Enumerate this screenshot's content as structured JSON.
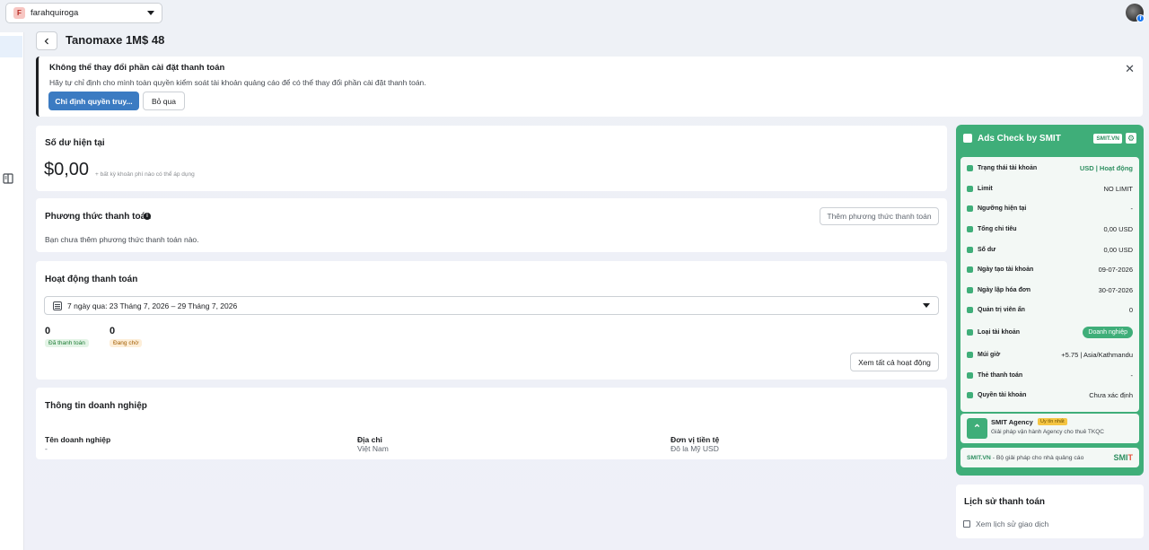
{
  "account": {
    "initial": "F",
    "name": "farahquiroga"
  },
  "header": {
    "title": "Tanomaxe 1M$ 48"
  },
  "banner": {
    "title": "Không thể thay đổi phần cài đặt thanh toán",
    "text": "Hãy tự chỉ định cho mình toàn quyền kiểm soát tài khoản quảng cáo để có thể thay đổi phần cài đặt thanh toán.",
    "primary_label": "Chỉ định quyền truy...",
    "secondary_label": "Bỏ qua"
  },
  "balance": {
    "title": "Số dư hiện tại",
    "amount": "$0,00",
    "note": "+ bất kỳ khoản phí nào có thể áp dụng"
  },
  "payment": {
    "title": "Phương thức thanh toán",
    "add_label": "Thêm phương thức thanh toán",
    "empty_text": "Bạn chưa thêm phương thức thanh toán nào."
  },
  "activity": {
    "title": "Hoạt động thanh toán",
    "date_range": "7 ngày qua: 23 Tháng 7, 2026 – 29 Tháng 7, 2026",
    "paid_count": "0",
    "paid_label": "Đã thanh toán",
    "pending_count": "0",
    "pending_label": "Đang chờ",
    "view_all_label": "Xem tất cả hoạt động"
  },
  "business": {
    "title": "Thông tin doanh nghiệp",
    "fields": [
      {
        "label": "Tên doanh nghiệp",
        "value": "-"
      },
      {
        "label": "Địa chỉ",
        "value": "Việt Nam"
      },
      {
        "label": "Đơn vị tiền tệ",
        "value": "Đô la Mỹ USD"
      }
    ]
  },
  "adscheck": {
    "title": "Ads Check by SMIT",
    "badge": "SMIT.VN",
    "rows": [
      {
        "label": "Trạng thái tài khoản",
        "value": "USD | Hoạt động"
      },
      {
        "label": "Limit",
        "value": "NO LIMIT"
      },
      {
        "label": "Ngưỡng hiện tại",
        "value": "-"
      },
      {
        "label": "Tổng chi tiêu",
        "value": "0,00 USD"
      },
      {
        "label": "Số dư",
        "value": "0,00 USD"
      },
      {
        "label": "Ngày tạo tài khoản",
        "value": "09-07-2026"
      },
      {
        "label": "Ngày lập hóa đơn",
        "value": "30-07-2026"
      },
      {
        "label": "Quản trị viên ẩn",
        "value": "0"
      },
      {
        "label": "Loại tài khoản",
        "value": "Doanh nghiệp"
      },
      {
        "label": "Múi giờ",
        "value": "+5.75 | Asia/Kathmandu"
      },
      {
        "label": "Thẻ thanh toán",
        "value": "-"
      },
      {
        "label": "Quyền tài khoản",
        "value": "Chưa xác định"
      }
    ],
    "agency": {
      "name": "SMIT Agency",
      "tag": "Uy tín nhất",
      "desc": "Giải pháp vận hành Agency cho thuê TKQC"
    },
    "footer": {
      "brand": "SMIT.VN",
      "text": " - Bộ giải pháp cho nhà quảng cáo",
      "logo_main": "SMI",
      "logo_accent": "T"
    }
  },
  "history": {
    "title": "Lịch sử thanh toán",
    "link_label": "Xem lịch sử giao dịch"
  }
}
